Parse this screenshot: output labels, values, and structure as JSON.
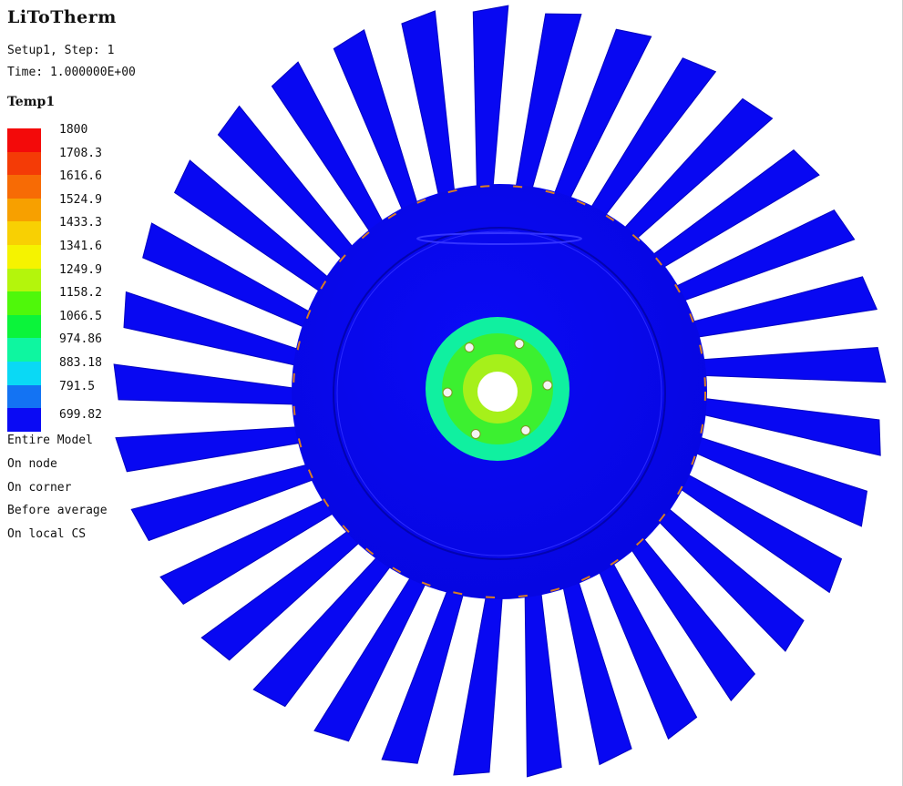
{
  "app": {
    "title": "LiToTherm"
  },
  "info": {
    "step": "Setup1, Step: 1",
    "time": "Time: 1.000000E+00"
  },
  "legend": {
    "title": "Temp1",
    "entries": [
      {
        "label": "1800",
        "color": "#f30a0a"
      },
      {
        "label": "1708.3",
        "color": "#f43b06"
      },
      {
        "label": "1616.6",
        "color": "#f76b05"
      },
      {
        "label": "1524.9",
        "color": "#f7a000"
      },
      {
        "label": "1433.3",
        "color": "#f8d003"
      },
      {
        "label": "1341.6",
        "color": "#f5f300"
      },
      {
        "label": "1249.9",
        "color": "#b4f50c"
      },
      {
        "label": "1158.2",
        "color": "#4ff80a"
      },
      {
        "label": "1066.5",
        "color": "#0bf43a"
      },
      {
        "label": "974.86",
        "color": "#0ef6a0"
      },
      {
        "label": "883.18",
        "color": "#0ad9f5"
      },
      {
        "label": "791.5",
        "color": "#1373f3"
      },
      {
        "label": "699.82",
        "color": "#0a0af4"
      }
    ]
  },
  "options": {
    "scope": "Entire Model",
    "location": "On node",
    "position": "On corner",
    "averaging": "Before average",
    "coordinate_system": "On local CS"
  },
  "model": {
    "blade_count": 33,
    "bolt_hole_count": 6,
    "colors": {
      "cold": "#0808f2",
      "cold_dark": "#0505c8",
      "hub_outer": "#10f0a0",
      "hub_mid": "#3cf030",
      "hub_inner": "#9ef01e",
      "edge_warm": "#f58a10"
    }
  }
}
